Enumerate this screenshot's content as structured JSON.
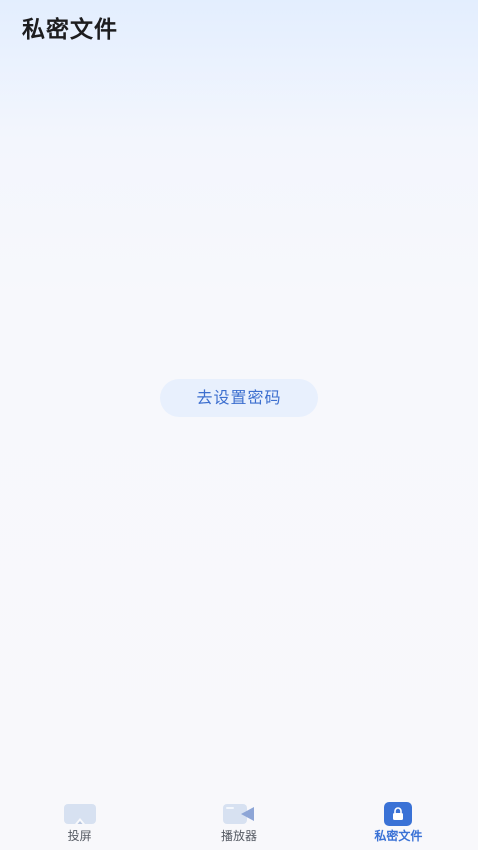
{
  "header": {
    "title": "私密文件"
  },
  "main": {
    "set_password_label": "去设置密码"
  },
  "tabbar": {
    "active_color": "#3a72d6",
    "inactive_icon_color": "#cfd9ec",
    "items": [
      {
        "label": "投屏",
        "icon": "screen-cast-icon",
        "active": false
      },
      {
        "label": "播放器",
        "icon": "video-player-icon",
        "active": false
      },
      {
        "label": "私密文件",
        "icon": "lock-icon",
        "active": true
      }
    ]
  }
}
